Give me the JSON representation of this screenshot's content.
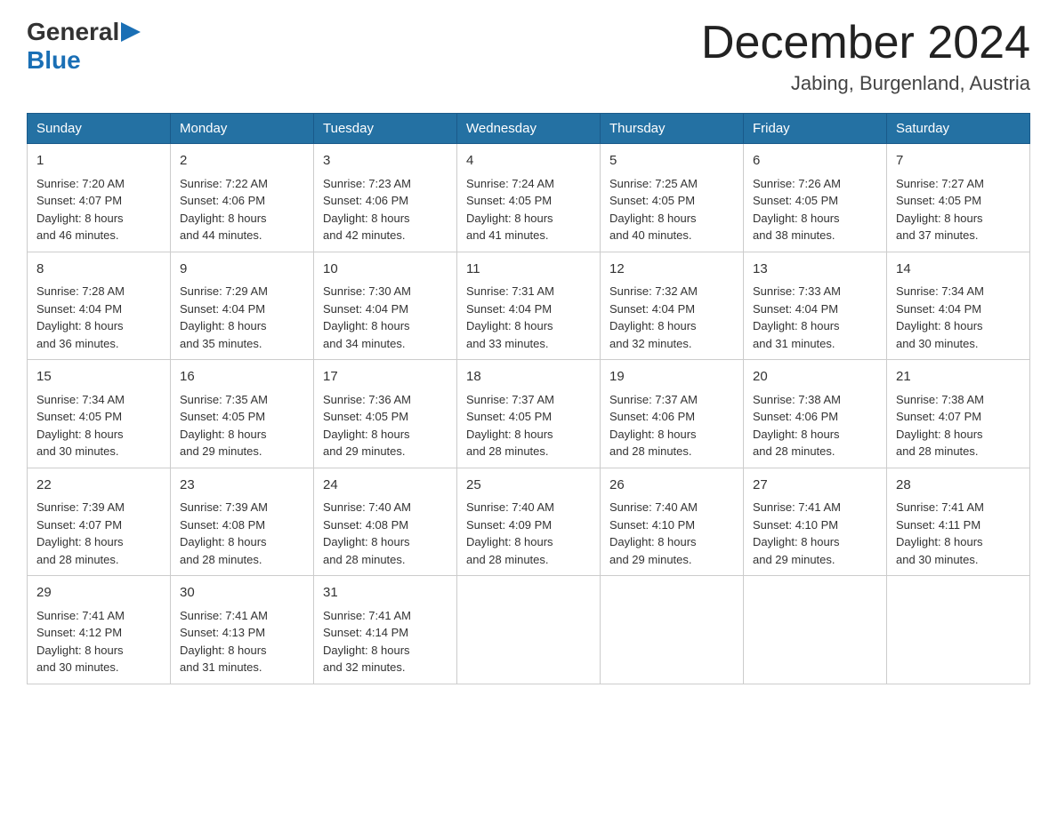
{
  "logo": {
    "general": "General",
    "blue": "Blue"
  },
  "title": "December 2024",
  "location": "Jabing, Burgenland, Austria",
  "days_of_week": [
    "Sunday",
    "Monday",
    "Tuesday",
    "Wednesday",
    "Thursday",
    "Friday",
    "Saturday"
  ],
  "weeks": [
    [
      {
        "day": "1",
        "sunrise": "7:20 AM",
        "sunset": "4:07 PM",
        "daylight": "8 hours and 46 minutes."
      },
      {
        "day": "2",
        "sunrise": "7:22 AM",
        "sunset": "4:06 PM",
        "daylight": "8 hours and 44 minutes."
      },
      {
        "day": "3",
        "sunrise": "7:23 AM",
        "sunset": "4:06 PM",
        "daylight": "8 hours and 42 minutes."
      },
      {
        "day": "4",
        "sunrise": "7:24 AM",
        "sunset": "4:05 PM",
        "daylight": "8 hours and 41 minutes."
      },
      {
        "day": "5",
        "sunrise": "7:25 AM",
        "sunset": "4:05 PM",
        "daylight": "8 hours and 40 minutes."
      },
      {
        "day": "6",
        "sunrise": "7:26 AM",
        "sunset": "4:05 PM",
        "daylight": "8 hours and 38 minutes."
      },
      {
        "day": "7",
        "sunrise": "7:27 AM",
        "sunset": "4:05 PM",
        "daylight": "8 hours and 37 minutes."
      }
    ],
    [
      {
        "day": "8",
        "sunrise": "7:28 AM",
        "sunset": "4:04 PM",
        "daylight": "8 hours and 36 minutes."
      },
      {
        "day": "9",
        "sunrise": "7:29 AM",
        "sunset": "4:04 PM",
        "daylight": "8 hours and 35 minutes."
      },
      {
        "day": "10",
        "sunrise": "7:30 AM",
        "sunset": "4:04 PM",
        "daylight": "8 hours and 34 minutes."
      },
      {
        "day": "11",
        "sunrise": "7:31 AM",
        "sunset": "4:04 PM",
        "daylight": "8 hours and 33 minutes."
      },
      {
        "day": "12",
        "sunrise": "7:32 AM",
        "sunset": "4:04 PM",
        "daylight": "8 hours and 32 minutes."
      },
      {
        "day": "13",
        "sunrise": "7:33 AM",
        "sunset": "4:04 PM",
        "daylight": "8 hours and 31 minutes."
      },
      {
        "day": "14",
        "sunrise": "7:34 AM",
        "sunset": "4:04 PM",
        "daylight": "8 hours and 30 minutes."
      }
    ],
    [
      {
        "day": "15",
        "sunrise": "7:34 AM",
        "sunset": "4:05 PM",
        "daylight": "8 hours and 30 minutes."
      },
      {
        "day": "16",
        "sunrise": "7:35 AM",
        "sunset": "4:05 PM",
        "daylight": "8 hours and 29 minutes."
      },
      {
        "day": "17",
        "sunrise": "7:36 AM",
        "sunset": "4:05 PM",
        "daylight": "8 hours and 29 minutes."
      },
      {
        "day": "18",
        "sunrise": "7:37 AM",
        "sunset": "4:05 PM",
        "daylight": "8 hours and 28 minutes."
      },
      {
        "day": "19",
        "sunrise": "7:37 AM",
        "sunset": "4:06 PM",
        "daylight": "8 hours and 28 minutes."
      },
      {
        "day": "20",
        "sunrise": "7:38 AM",
        "sunset": "4:06 PM",
        "daylight": "8 hours and 28 minutes."
      },
      {
        "day": "21",
        "sunrise": "7:38 AM",
        "sunset": "4:07 PM",
        "daylight": "8 hours and 28 minutes."
      }
    ],
    [
      {
        "day": "22",
        "sunrise": "7:39 AM",
        "sunset": "4:07 PM",
        "daylight": "8 hours and 28 minutes."
      },
      {
        "day": "23",
        "sunrise": "7:39 AM",
        "sunset": "4:08 PM",
        "daylight": "8 hours and 28 minutes."
      },
      {
        "day": "24",
        "sunrise": "7:40 AM",
        "sunset": "4:08 PM",
        "daylight": "8 hours and 28 minutes."
      },
      {
        "day": "25",
        "sunrise": "7:40 AM",
        "sunset": "4:09 PM",
        "daylight": "8 hours and 28 minutes."
      },
      {
        "day": "26",
        "sunrise": "7:40 AM",
        "sunset": "4:10 PM",
        "daylight": "8 hours and 29 minutes."
      },
      {
        "day": "27",
        "sunrise": "7:41 AM",
        "sunset": "4:10 PM",
        "daylight": "8 hours and 29 minutes."
      },
      {
        "day": "28",
        "sunrise": "7:41 AM",
        "sunset": "4:11 PM",
        "daylight": "8 hours and 30 minutes."
      }
    ],
    [
      {
        "day": "29",
        "sunrise": "7:41 AM",
        "sunset": "4:12 PM",
        "daylight": "8 hours and 30 minutes."
      },
      {
        "day": "30",
        "sunrise": "7:41 AM",
        "sunset": "4:13 PM",
        "daylight": "8 hours and 31 minutes."
      },
      {
        "day": "31",
        "sunrise": "7:41 AM",
        "sunset": "4:14 PM",
        "daylight": "8 hours and 32 minutes."
      },
      null,
      null,
      null,
      null
    ]
  ],
  "labels": {
    "sunrise": "Sunrise:",
    "sunset": "Sunset:",
    "daylight": "Daylight:"
  }
}
